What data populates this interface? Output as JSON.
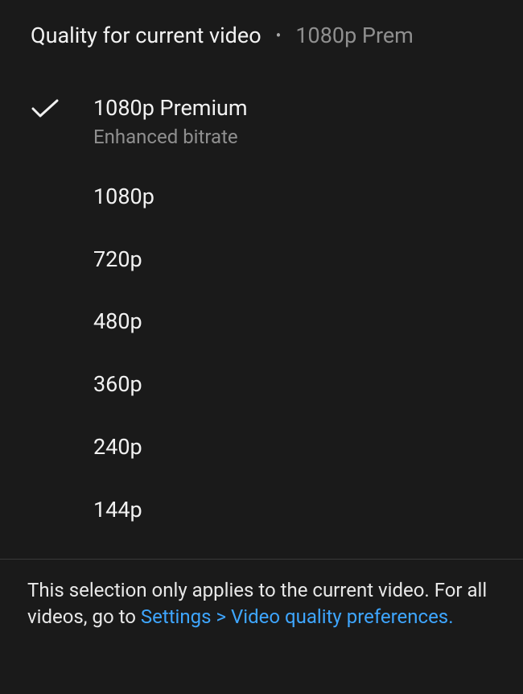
{
  "header": {
    "title": "Quality for current video",
    "current_quality": "1080p Prem"
  },
  "options": [
    {
      "label": "1080p Premium",
      "sublabel": "Enhanced bitrate",
      "selected": true
    },
    {
      "label": "1080p",
      "sublabel": null,
      "selected": false
    },
    {
      "label": "720p",
      "sublabel": null,
      "selected": false
    },
    {
      "label": "480p",
      "sublabel": null,
      "selected": false
    },
    {
      "label": "360p",
      "sublabel": null,
      "selected": false
    },
    {
      "label": "240p",
      "sublabel": null,
      "selected": false
    },
    {
      "label": "144p",
      "sublabel": null,
      "selected": false
    }
  ],
  "footer": {
    "text_before": "This selection only applies to the current video. For all videos, go to ",
    "link_text": "Settings > Video quality preferences."
  }
}
